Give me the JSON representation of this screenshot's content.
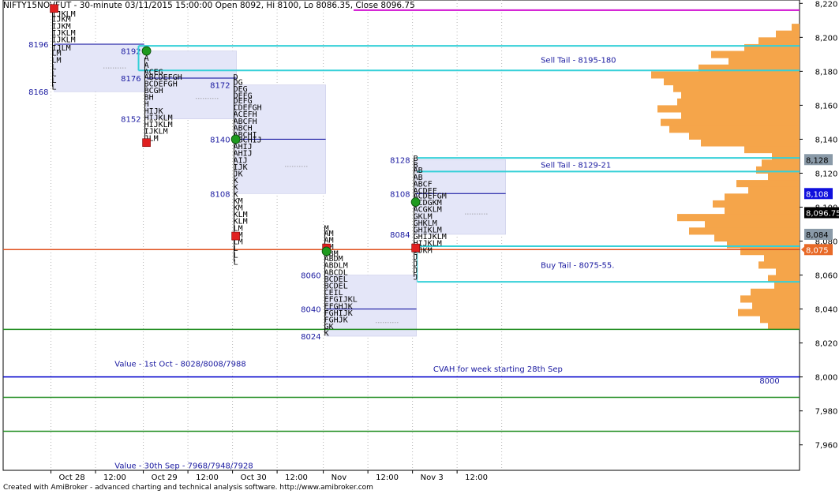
{
  "header": {
    "title": "NIFTY15NOVFUT - 30-minute 03/11/2015 15:00:00 Open 8092, Hi 8100, Lo 8086.35, Close 8096.75"
  },
  "footer": {
    "text": "Created with AmiBroker - advanced charting and technical analysis software. http://www.amibroker.com"
  },
  "colors": {
    "profile_fill": "#f5a54a",
    "value_area": "#e4e6f8",
    "cyan_line": "#35d0d8",
    "green_line": "#1e8c1e",
    "blue_line": "#0000cc",
    "orange_line": "#e0501e",
    "magenta_line": "#d010d0",
    "badge": "#8a9aa8",
    "badge_blue": "#1010dd",
    "badge_orange": "#e86a28"
  },
  "chart_data": {
    "type": "market_profile",
    "ylim": [
      7945,
      8222
    ],
    "y_ticks": [
      "8,220",
      "8,200",
      "8,180",
      "8,160",
      "8,140",
      "8,120",
      "8,100",
      "8,080",
      "8,060",
      "8,040",
      "8,020",
      "8,000",
      "7,980",
      "7,960"
    ],
    "y_tick_values": [
      8220,
      8200,
      8180,
      8160,
      8140,
      8120,
      8100,
      8080,
      8060,
      8040,
      8020,
      8000,
      7980,
      7960
    ],
    "x_ticks": [
      "Oct 28",
      "12:00",
      "Oct 29",
      "12:00",
      "Oct 30",
      "12:00",
      "Nov",
      "12:00",
      "Nov 3",
      "12:00"
    ],
    "price_badges": [
      {
        "label": "8,128",
        "value": 8128,
        "style": "grey"
      },
      {
        "label": "8,108",
        "value": 8108,
        "style": "blue"
      },
      {
        "label": "8,096.75",
        "value": 8096.75,
        "style": "black"
      },
      {
        "label": "8,084",
        "value": 8084,
        "style": "grey"
      },
      {
        "label": "8,075",
        "value": 8075,
        "style": "orange"
      }
    ],
    "horizontal_lines": [
      {
        "name": "magenta",
        "value": 8216,
        "from": 0.44
      },
      {
        "name": "cyan-8195",
        "value": 8195,
        "from": 0.17
      },
      {
        "name": "cyan-8180",
        "value": 8180.5,
        "from": 0.17
      },
      {
        "name": "cyan-8129",
        "value": 8129,
        "from": 0.52
      },
      {
        "name": "cyan-8121",
        "value": 8121,
        "from": 0.52
      },
      {
        "name": "cyan-8077",
        "value": 8077,
        "from": 0.52
      },
      {
        "name": "cyan-8056",
        "value": 8056,
        "from": 0.52
      },
      {
        "name": "orange-8075",
        "value": 8075,
        "from": 0.0
      },
      {
        "name": "green-8028",
        "value": 8028,
        "from": 0.0
      },
      {
        "name": "blue-8000",
        "value": 8000,
        "from": 0.0
      },
      {
        "name": "green-7988",
        "value": 7988,
        "from": 0.0
      },
      {
        "name": "green-7968",
        "value": 7968,
        "from": 0.0
      }
    ],
    "annotations": [
      {
        "text": "Sell Tail - 8195-180",
        "value": 8187
      },
      {
        "text": "Sell Tail - 8129-21",
        "value": 8125
      },
      {
        "text": "Buy Tail - 8075-55.",
        "value": 8066
      },
      {
        "text": "Value - 1st Oct - 8028/8008/7988",
        "value": 8008
      },
      {
        "text": "CVAH for week starting 28th Sep",
        "value": 8005
      },
      {
        "text": "8000",
        "value": 7998
      },
      {
        "text": "Value - 30th Sep - 7968/7948/7928",
        "value": 7948
      }
    ],
    "sessions": [
      {
        "name": "Oct 28",
        "x": 0.06,
        "va_high": 8196,
        "poc": 8196,
        "va_low": 8168,
        "labels": [
          {
            "t": "8196",
            "v": 8196
          },
          {
            "t": "8168",
            "v": 8168
          }
        ],
        "tpo": [
          {
            "p": 8217,
            "s": "L"
          },
          {
            "p": 8214,
            "s": "IJKLM"
          },
          {
            "p": 8211,
            "s": "IJKM"
          },
          {
            "p": 8207,
            "s": "IJKM"
          },
          {
            "p": 8203,
            "s": "IJKLM"
          },
          {
            "p": 8199,
            "s": "IJKLM"
          },
          {
            "p": 8194,
            "s": "IJLM"
          },
          {
            "p": 8191,
            "s": "LM"
          },
          {
            "p": 8187,
            "s": "LM"
          },
          {
            "p": 8183,
            "s": "L"
          },
          {
            "p": 8179,
            "s": "L"
          },
          {
            "p": 8175,
            "s": "L"
          },
          {
            "p": 8171,
            "s": "L"
          }
        ]
      },
      {
        "name": "Oct 29",
        "x": 0.176,
        "va_high": 8192,
        "poc": 8176,
        "va_low": 8152,
        "labels": [
          {
            "t": "8192",
            "v": 8192
          },
          {
            "t": "8176",
            "v": 8176
          },
          {
            "t": "8152",
            "v": 8152
          }
        ],
        "tpo": [
          {
            "p": 8188,
            "s": "A"
          },
          {
            "p": 8184,
            "s": "A"
          },
          {
            "p": 8180,
            "s": "ACEG"
          },
          {
            "p": 8177,
            "s": "ABCDEFGH"
          },
          {
            "p": 8173,
            "s": "BCDEFGH"
          },
          {
            "p": 8169,
            "s": "BCGH"
          },
          {
            "p": 8165,
            "s": "BH"
          },
          {
            "p": 8161,
            "s": "H"
          },
          {
            "p": 8157,
            "s": "HIJK"
          },
          {
            "p": 8153,
            "s": "HIJKLM"
          },
          {
            "p": 8149,
            "s": "HIJKLM"
          },
          {
            "p": 8145,
            "s": "IJKLM"
          },
          {
            "p": 8141,
            "s": "JLM"
          },
          {
            "p": 8138,
            "s": "M"
          }
        ]
      },
      {
        "name": "Oct 30",
        "x": 0.288,
        "va_high": 8172,
        "poc": 8140,
        "va_low": 8108,
        "labels": [
          {
            "t": "8172",
            "v": 8172
          },
          {
            "t": "8140",
            "v": 8140
          },
          {
            "t": "8108",
            "v": 8108
          }
        ],
        "tpo": [
          {
            "p": 8177,
            "s": "D"
          },
          {
            "p": 8174,
            "s": "DG"
          },
          {
            "p": 8170,
            "s": "DEG"
          },
          {
            "p": 8166,
            "s": "DEFG"
          },
          {
            "p": 8163,
            "s": "DEFG"
          },
          {
            "p": 8159,
            "s": "CDEFGH"
          },
          {
            "p": 8155,
            "s": "ACEFH"
          },
          {
            "p": 8151,
            "s": "ABCFH"
          },
          {
            "p": 8147,
            "s": "ABCH"
          },
          {
            "p": 8143,
            "s": "ABCHI"
          },
          {
            "p": 8140,
            "s": "ABCHIJ"
          },
          {
            "p": 8136,
            "s": "AHIJ"
          },
          {
            "p": 8132,
            "s": "AHIJ"
          },
          {
            "p": 8128,
            "s": "AIJ"
          },
          {
            "p": 8124,
            "s": "IJK"
          },
          {
            "p": 8120,
            "s": "JK"
          },
          {
            "p": 8116,
            "s": "K"
          },
          {
            "p": 8112,
            "s": "K"
          },
          {
            "p": 8108,
            "s": "K"
          },
          {
            "p": 8104,
            "s": "KM"
          },
          {
            "p": 8100,
            "s": "KM"
          },
          {
            "p": 8096,
            "s": "KLM"
          },
          {
            "p": 8092,
            "s": "KLM"
          },
          {
            "p": 8088,
            "s": "LM"
          },
          {
            "p": 8084,
            "s": "LM"
          },
          {
            "p": 8080,
            "s": "LM"
          },
          {
            "p": 8076,
            "s": "L"
          },
          {
            "p": 8072,
            "s": "L"
          },
          {
            "p": 8068,
            "s": "L"
          }
        ]
      },
      {
        "name": "Nov 2",
        "x": 0.402,
        "va_high": 8060,
        "poc": 8040,
        "va_low": 8024,
        "labels": [
          {
            "t": "8060",
            "v": 8060
          },
          {
            "t": "8040",
            "v": 8040
          },
          {
            "t": "8024",
            "v": 8024
          }
        ],
        "tpo": [
          {
            "p": 8088,
            "s": "M"
          },
          {
            "p": 8085,
            "s": "AM"
          },
          {
            "p": 8081,
            "s": "AM"
          },
          {
            "p": 8077,
            "s": "AM"
          },
          {
            "p": 8073,
            "s": "ABM"
          },
          {
            "p": 8070,
            "s": "ABDM"
          },
          {
            "p": 8066,
            "s": "ABDLM"
          },
          {
            "p": 8062,
            "s": "ABCDL"
          },
          {
            "p": 8058,
            "s": "BCDEL"
          },
          {
            "p": 8054,
            "s": "BCDEL"
          },
          {
            "p": 8050,
            "s": "CEIL"
          },
          {
            "p": 8046,
            "s": "EFGIJKL"
          },
          {
            "p": 8042,
            "s": "EFGHJK"
          },
          {
            "p": 8038,
            "s": "FGHIJK"
          },
          {
            "p": 8034,
            "s": "FGHJK"
          },
          {
            "p": 8030,
            "s": "GK"
          },
          {
            "p": 8026,
            "s": "K"
          }
        ]
      },
      {
        "name": "Nov 3",
        "x": 0.514,
        "va_high": 8128,
        "poc": 8108,
        "va_low": 8084,
        "labels": [
          {
            "t": "8128",
            "v": 8128
          },
          {
            "t": "8108",
            "v": 8108
          },
          {
            "t": "8084",
            "v": 8084
          }
        ],
        "tpo": [
          {
            "p": 8129,
            "s": "B"
          },
          {
            "p": 8125,
            "s": "B"
          },
          {
            "p": 8122,
            "s": "AB"
          },
          {
            "p": 8118,
            "s": "AB"
          },
          {
            "p": 8114,
            "s": "ABCF"
          },
          {
            "p": 8110,
            "s": "ACDEF"
          },
          {
            "p": 8107,
            "s": "ACDEFGM"
          },
          {
            "p": 8103,
            "s": "ACDGKM"
          },
          {
            "p": 8099,
            "s": "ACGKLM"
          },
          {
            "p": 8095,
            "s": "GKLM"
          },
          {
            "p": 8091,
            "s": "GHKLM"
          },
          {
            "p": 8087,
            "s": "GHIKLM"
          },
          {
            "p": 8083,
            "s": "GHIJKLM"
          },
          {
            "p": 8079,
            "s": "HIJKLM"
          },
          {
            "p": 8075,
            "s": "IJKM"
          },
          {
            "p": 8071,
            "s": "J"
          },
          {
            "p": 8067,
            "s": "J"
          },
          {
            "p": 8063,
            "s": "J"
          },
          {
            "p": 8059,
            "s": "J"
          }
        ]
      }
    ],
    "markers": [
      {
        "session": 0,
        "price": 8217,
        "kind": "red"
      },
      {
        "session": 1,
        "price": 8192,
        "kind": "green"
      },
      {
        "session": 1,
        "price": 8138,
        "kind": "red"
      },
      {
        "session": 2,
        "price": 8140,
        "kind": "green"
      },
      {
        "session": 2,
        "price": 8083,
        "kind": "red"
      },
      {
        "session": 3,
        "price": 8076,
        "kind": "red"
      },
      {
        "session": 3,
        "price": 8074,
        "kind": "green"
      },
      {
        "session": 4,
        "price": 8103,
        "kind": "green"
      },
      {
        "session": 4,
        "price": 8076,
        "kind": "red"
      }
    ],
    "volume_profile": [
      [
        8206,
        10
      ],
      [
        8202,
        30
      ],
      [
        8198,
        52
      ],
      [
        8194,
        70
      ],
      [
        8190,
        112
      ],
      [
        8186,
        90
      ],
      [
        8182,
        128
      ],
      [
        8178,
        188
      ],
      [
        8174,
        172
      ],
      [
        8170,
        160
      ],
      [
        8166,
        150
      ],
      [
        8162,
        155
      ],
      [
        8158,
        180
      ],
      [
        8154,
        150
      ],
      [
        8150,
        176
      ],
      [
        8146,
        165
      ],
      [
        8142,
        140
      ],
      [
        8138,
        125
      ],
      [
        8134,
        70
      ],
      [
        8130,
        35
      ],
      [
        8126,
        48
      ],
      [
        8122,
        55
      ],
      [
        8118,
        40
      ],
      [
        8114,
        80
      ],
      [
        8110,
        65
      ],
      [
        8106,
        95
      ],
      [
        8102,
        110
      ],
      [
        8098,
        95
      ],
      [
        8094,
        155
      ],
      [
        8090,
        120
      ],
      [
        8086,
        140
      ],
      [
        8082,
        108
      ],
      [
        8078,
        92
      ],
      [
        8074,
        75
      ],
      [
        8070,
        45
      ],
      [
        8066,
        52
      ],
      [
        8062,
        30
      ],
      [
        8058,
        40
      ],
      [
        8054,
        32
      ],
      [
        8050,
        62
      ],
      [
        8046,
        75
      ],
      [
        8042,
        60
      ],
      [
        8038,
        78
      ],
      [
        8034,
        50
      ],
      [
        8030,
        40
      ]
    ]
  }
}
